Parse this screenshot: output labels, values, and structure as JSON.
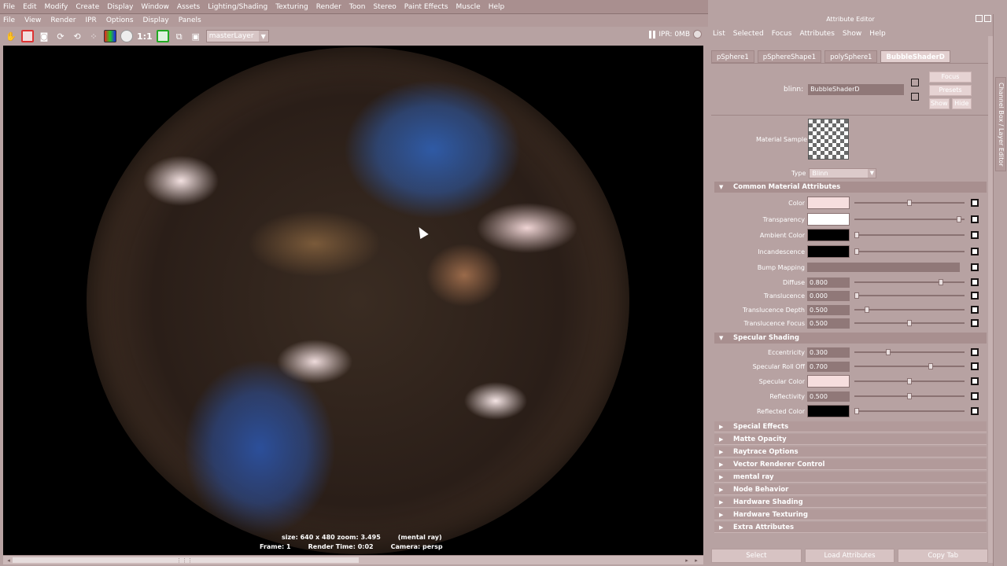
{
  "main_menu": [
    "File",
    "Edit",
    "Modify",
    "Create",
    "Display",
    "Window",
    "Assets",
    "Lighting/Shading",
    "Texturing",
    "Render",
    "Toon",
    "Stereo",
    "Paint Effects",
    "Muscle",
    "Help"
  ],
  "render_view_menu": [
    "File",
    "View",
    "Render",
    "IPR",
    "Options",
    "Display",
    "Panels"
  ],
  "toolbar": {
    "ratio_label": "1:1",
    "layer_dropdown": "masterLayer",
    "ipr_status": "IPR: 0MB"
  },
  "render_info": {
    "size": "size: 640 x 480 zoom: 3.495",
    "renderer": "(mental ray)",
    "frame": "Frame: 1",
    "render_time": "Render Time: 0:02",
    "camera": "Camera: persp"
  },
  "attribute_editor": {
    "title": "Attribute Editor",
    "menu": [
      "List",
      "Selected",
      "Focus",
      "Attributes",
      "Show",
      "Help"
    ],
    "tabs": [
      "pSphere1",
      "pSphereShape1",
      "polySphere1",
      "BubbleShaderD"
    ],
    "node_type_label": "blinn:",
    "node_name": "BubbleShaderD",
    "focus_btn": "Focus",
    "presets_btn": "Presets",
    "show_btn": "Show",
    "hide_btn": "Hide",
    "material_sample_label": "Material Sample",
    "type_label": "Type",
    "type_value": "Blinn",
    "sections": {
      "common": "Common Material Attributes",
      "specular": "Specular Shading",
      "collapsed": [
        "Special Effects",
        "Matte Opacity",
        "Raytrace Options",
        "Vector Renderer Control",
        "mental ray",
        "Node Behavior",
        "Hardware Shading",
        "Hardware Texturing",
        "Extra Attributes"
      ]
    },
    "common_attrs": {
      "color": "Color",
      "transparency": "Transparency",
      "ambient": "Ambient Color",
      "incandescence": "Incandescence",
      "bump": "Bump Mapping",
      "diffuse": "Diffuse",
      "diffuse_val": "0.800",
      "translucence": "Translucence",
      "translucence_val": "0.000",
      "trans_depth": "Translucence Depth",
      "trans_depth_val": "0.500",
      "trans_focus": "Translucence Focus",
      "trans_focus_val": "0.500"
    },
    "slider_levels": {
      "color": 0.5,
      "transparency": 0.97,
      "ambient": 0.0,
      "incandescence": 0.0,
      "diffuse": 0.8,
      "translucence": 0.0,
      "trans_depth": 0.1,
      "trans_focus": 0.5,
      "eccentricity": 0.3,
      "spec_rolloff": 0.7,
      "spec_color": 0.5,
      "reflectivity": 0.5,
      "reflected_color": 0.0
    },
    "specular_attrs": {
      "eccentricity": "Eccentricity",
      "eccentricity_val": "0.300",
      "rolloff": "Specular Roll Off",
      "rolloff_val": "0.700",
      "spec_color": "Specular Color",
      "reflectivity": "Reflectivity",
      "reflectivity_val": "0.500",
      "reflected_color": "Reflected Color"
    },
    "swatch_colors": {
      "color": "#f6dede",
      "transparency": "#ffffff",
      "ambient": "#000000",
      "incandescence": "#000000",
      "spec_color": "#f6dede",
      "reflected_color": "#000000"
    },
    "bottom_buttons": [
      "Select",
      "Load Attributes",
      "Copy Tab"
    ],
    "side_tab": "Channel Box / Layer Editor"
  }
}
